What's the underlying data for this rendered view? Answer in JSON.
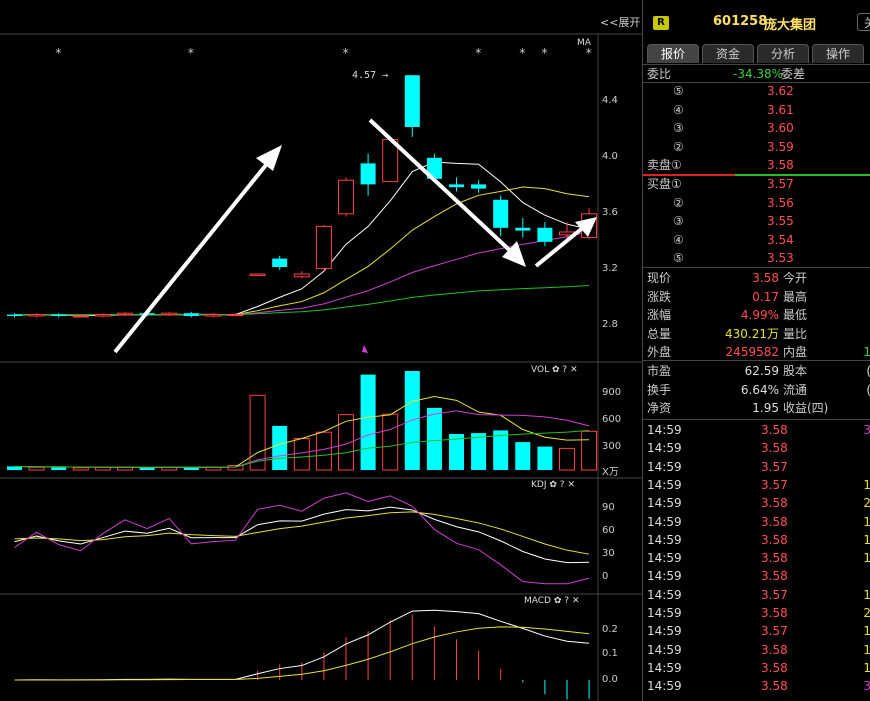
{
  "toolbar": {
    "expand_label": "<<展开"
  },
  "main_chart": {
    "indicator_label": "MA",
    "price_annotation": "4.57",
    "y_axis": [
      "4.4",
      "4.0",
      "3.6",
      "3.2",
      "2.8"
    ]
  },
  "vol_panel": {
    "title": "VOL",
    "y_axis": [
      "900",
      "600",
      "300"
    ],
    "unit": "X万"
  },
  "kdj_panel": {
    "title": "KDJ",
    "y_axis": [
      "90",
      "60",
      "30",
      "0"
    ]
  },
  "macd_panel": {
    "title": "MACD",
    "y_axis": [
      "0.2",
      "0.1",
      "0.0"
    ]
  },
  "stock": {
    "badge": "R",
    "code": "601258",
    "name": "庞大集团",
    "close_label": "关"
  },
  "tabs": [
    {
      "label": "报价",
      "active": true
    },
    {
      "label": "资金",
      "active": false
    },
    {
      "label": "分析",
      "active": false
    },
    {
      "label": "操作",
      "active": false
    }
  ],
  "order_ratio": {
    "label": "委比",
    "value": "-34.38%",
    "diff_label": "委差"
  },
  "asks": [
    {
      "label": "⑤",
      "price": "3.62"
    },
    {
      "label": "④",
      "price": "3.61"
    },
    {
      "label": "③",
      "price": "3.60"
    },
    {
      "label": "②",
      "price": "3.59"
    },
    {
      "label": "卖盘①",
      "price": "3.58"
    }
  ],
  "bids": [
    {
      "label": "买盘①",
      "price": "3.57"
    },
    {
      "label": "②",
      "price": "3.56"
    },
    {
      "label": "③",
      "price": "3.55"
    },
    {
      "label": "④",
      "price": "3.54"
    },
    {
      "label": "⑤",
      "price": "3.53"
    }
  ],
  "quote": [
    {
      "label": "现价",
      "value": "3.58",
      "color": "#ff5050",
      "label2": "今开"
    },
    {
      "label": "涨跌",
      "value": "0.17",
      "color": "#ff5050",
      "label2": "最高"
    },
    {
      "label": "涨幅",
      "value": "4.99%",
      "color": "#ff5050",
      "label2": "最低"
    },
    {
      "label": "总量",
      "value": "430.21万",
      "color": "#e8e030",
      "label2": "量比"
    },
    {
      "label": "外盘",
      "value": "2459582",
      "color": "#ff5050",
      "label2": "内盘",
      "value2": "1"
    }
  ],
  "fundamentals": [
    {
      "label": "市盈",
      "value": "62.59",
      "label2": "股本",
      "value2": "("
    },
    {
      "label": "换手",
      "value": "6.64%",
      "label2": "流通",
      "value2": "("
    },
    {
      "label": "净资",
      "value": "1.95",
      "label2": "收益(四)",
      "value2": ""
    }
  ],
  "ticks": [
    {
      "time": "14:59",
      "price": "3.58",
      "vol": "3",
      "vcolor": "#d040d0"
    },
    {
      "time": "14:59",
      "price": "3.58",
      "vol": "",
      "vcolor": "#ff5050"
    },
    {
      "time": "14:59",
      "price": "3.57",
      "vol": "",
      "vcolor": "#ff5050"
    },
    {
      "time": "14:59",
      "price": "3.57",
      "vol": "1",
      "vcolor": "#e8e030"
    },
    {
      "time": "14:59",
      "price": "3.58",
      "vol": "2",
      "vcolor": "#e8e030"
    },
    {
      "time": "14:59",
      "price": "3.58",
      "vol": "1",
      "vcolor": "#e8e030"
    },
    {
      "time": "14:59",
      "price": "3.58",
      "vol": "1",
      "vcolor": "#e8e030"
    },
    {
      "time": "14:59",
      "price": "3.58",
      "vol": "1",
      "vcolor": "#e8e030"
    },
    {
      "time": "14:59",
      "price": "3.58",
      "vol": "",
      "vcolor": "#ff5050"
    },
    {
      "time": "14:59",
      "price": "3.57",
      "vol": "1",
      "vcolor": "#e8e030"
    },
    {
      "time": "14:59",
      "price": "3.58",
      "vol": "2",
      "vcolor": "#e8e030"
    },
    {
      "time": "14:59",
      "price": "3.57",
      "vol": "1",
      "vcolor": "#e8e030"
    },
    {
      "time": "14:59",
      "price": "3.58",
      "vol": "1",
      "vcolor": "#e8e030"
    },
    {
      "time": "14:59",
      "price": "3.58",
      "vol": "1",
      "vcolor": "#e8e030"
    },
    {
      "time": "14:59",
      "price": "3.58",
      "vol": "3",
      "vcolor": "#d040d0"
    }
  ],
  "candles": [
    {
      "o": 2.86,
      "c": 2.85,
      "h": 2.87,
      "l": 2.84,
      "v": 40
    },
    {
      "o": 2.85,
      "c": 2.86,
      "h": 2.87,
      "l": 2.84,
      "v": 30
    },
    {
      "o": 2.86,
      "c": 2.85,
      "h": 2.87,
      "l": 2.84,
      "v": 35
    },
    {
      "o": 2.85,
      "c": 2.85,
      "h": 2.86,
      "l": 2.84,
      "v": 25
    },
    {
      "o": 2.85,
      "c": 2.86,
      "h": 2.87,
      "l": 2.84,
      "v": 30
    },
    {
      "o": 2.86,
      "c": 2.87,
      "h": 2.88,
      "l": 2.85,
      "v": 30
    },
    {
      "o": 2.87,
      "c": 2.86,
      "h": 2.88,
      "l": 2.85,
      "v": 28
    },
    {
      "o": 2.86,
      "c": 2.87,
      "h": 2.88,
      "l": 2.85,
      "v": 30
    },
    {
      "o": 2.87,
      "c": 2.85,
      "h": 2.88,
      "l": 2.84,
      "v": 32
    },
    {
      "o": 2.85,
      "c": 2.86,
      "h": 2.87,
      "l": 2.84,
      "v": 30
    },
    {
      "o": 2.86,
      "c": 2.86,
      "h": 2.87,
      "l": 2.85,
      "v": 50
    },
    {
      "o": 3.14,
      "c": 3.15,
      "h": 3.15,
      "l": 3.14,
      "v": 830
    },
    {
      "o": 3.26,
      "c": 3.2,
      "h": 3.28,
      "l": 3.18,
      "v": 490
    },
    {
      "o": 3.13,
      "c": 3.15,
      "h": 3.17,
      "l": 3.12,
      "v": 350
    },
    {
      "o": 3.19,
      "c": 3.49,
      "h": 3.5,
      "l": 3.17,
      "v": 420
    },
    {
      "o": 3.58,
      "c": 3.82,
      "h": 3.84,
      "l": 3.56,
      "v": 615
    },
    {
      "o": 3.94,
      "c": 3.79,
      "h": 4.01,
      "l": 3.71,
      "v": 1060
    },
    {
      "o": 3.81,
      "c": 4.11,
      "h": 4.12,
      "l": 3.81,
      "v": 620
    },
    {
      "o": 4.57,
      "c": 4.2,
      "h": 4.57,
      "l": 4.13,
      "v": 1100
    },
    {
      "o": 3.98,
      "c": 3.83,
      "h": 4.01,
      "l": 3.81,
      "v": 690
    },
    {
      "o": 3.79,
      "c": 3.77,
      "h": 3.84,
      "l": 3.74,
      "v": 400
    },
    {
      "o": 3.79,
      "c": 3.76,
      "h": 3.82,
      "l": 3.73,
      "v": 410
    },
    {
      "o": 3.68,
      "c": 3.48,
      "h": 3.71,
      "l": 3.42,
      "v": 440
    },
    {
      "o": 3.48,
      "c": 3.46,
      "h": 3.55,
      "l": 3.41,
      "v": 310
    },
    {
      "o": 3.48,
      "c": 3.38,
      "h": 3.52,
      "l": 3.35,
      "v": 260
    },
    {
      "o": 3.43,
      "c": 3.45,
      "h": 3.52,
      "l": 3.4,
      "v": 240
    },
    {
      "o": 3.41,
      "c": 3.58,
      "h": 3.62,
      "l": 3.4,
      "v": 430
    }
  ],
  "stars": [
    2,
    8,
    15,
    21,
    23,
    24,
    26
  ]
}
